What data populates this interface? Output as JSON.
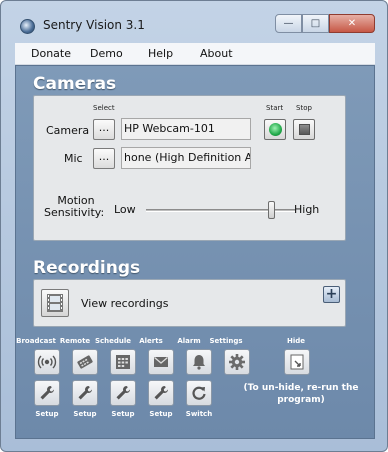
{
  "window": {
    "title": "Sentry Vision 3.1",
    "minimize": "—",
    "maximize": "□",
    "close": "✕"
  },
  "menu": [
    "Donate",
    "Demo",
    "Help",
    "About"
  ],
  "cameras": {
    "heading": "Cameras",
    "select_label": "Select",
    "start_label": "Start",
    "stop_label": "Stop",
    "camera_label": "Camera",
    "camera_value": "HP Webcam-101",
    "mic_label": "Mic",
    "mic_value": "hone (High Definition Aud",
    "dots": "...",
    "motion_label_1": "Motion",
    "motion_label_2": "Sensitivity:",
    "low": "Low",
    "high": "High",
    "sensitivity_level": 0.83
  },
  "recordings": {
    "heading": "Recordings",
    "view_label": "View recordings",
    "plus": "+"
  },
  "toolbar": {
    "top_labels": [
      "Broadcast",
      "Remote",
      "Schedule",
      "Alerts",
      "Alarm",
      "Settings",
      "Hide"
    ],
    "bottom_labels": [
      "Setup",
      "Setup",
      "Setup",
      "Setup",
      "Switch"
    ],
    "hide_note": "(To un-hide, re-run the program)"
  },
  "colors": {
    "accent": "#7f9ab8",
    "start_green": "#22a94a"
  }
}
